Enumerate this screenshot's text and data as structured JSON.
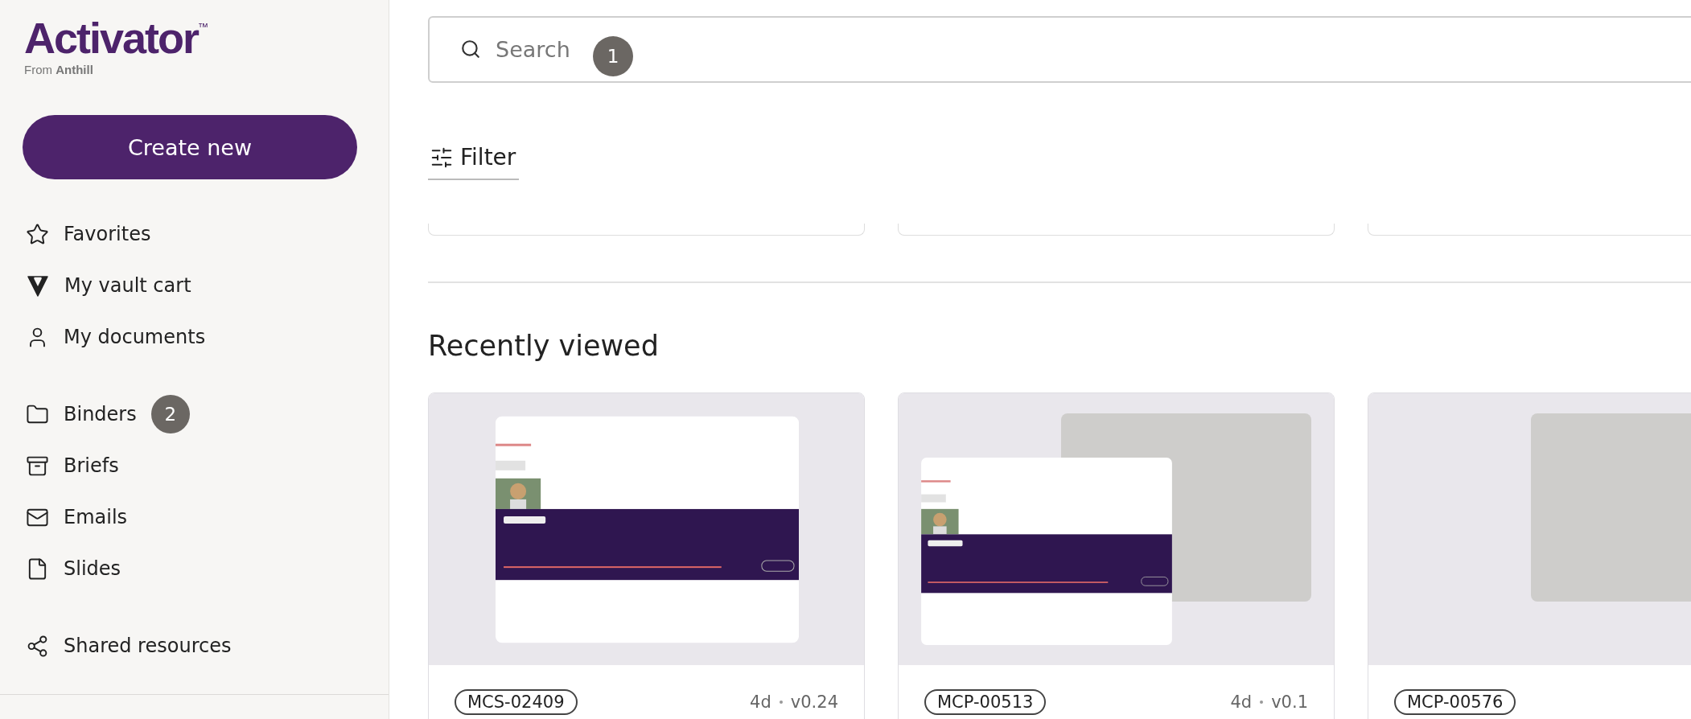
{
  "sidebar": {
    "logo": "Activator",
    "trademark": "™",
    "tagline_prefix": "From",
    "tagline_brand": "Anthill",
    "create_button": "Create new",
    "nav_groups": [
      [
        {
          "label": "Favorites"
        },
        {
          "label": "My vault cart"
        },
        {
          "label": "My documents"
        }
      ],
      [
        {
          "label": "Binders",
          "badge": "2"
        },
        {
          "label": "Briefs"
        },
        {
          "label": "Emails"
        },
        {
          "label": "Slides"
        }
      ],
      [
        {
          "label": "Shared resources"
        }
      ]
    ]
  },
  "search": {
    "placeholder": "Search",
    "badge": "1"
  },
  "filter": {
    "label": "Filter"
  },
  "recently_viewed": {
    "title": "Recently viewed",
    "cards": [
      {
        "kind": "single",
        "code": "MCS-02409",
        "age": "4d",
        "version": "v0.24"
      },
      {
        "kind": "stacked",
        "code": "MCP-00513",
        "age": "4d",
        "version": "v0.1"
      },
      {
        "kind": "empty",
        "code": "MCP-00576"
      }
    ]
  }
}
